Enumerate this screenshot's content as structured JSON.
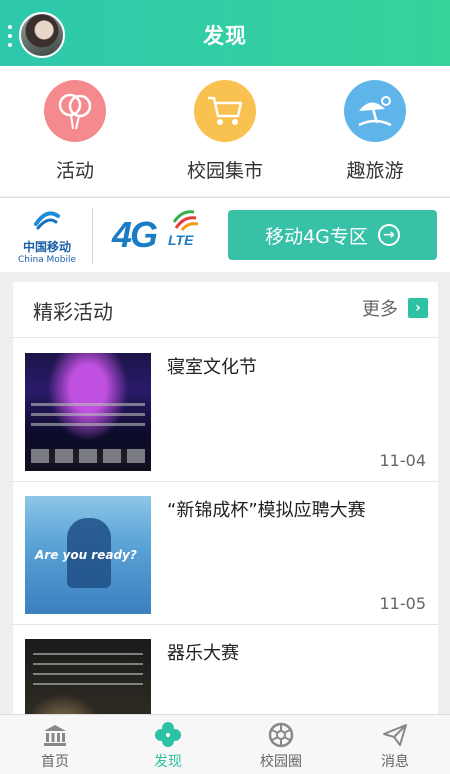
{
  "header": {
    "title": "发现"
  },
  "quick_nav": [
    {
      "label": "活动",
      "icon": "balloon-icon",
      "color": "#f48a8e"
    },
    {
      "label": "校园集市",
      "icon": "shopping-cart-icon",
      "color": "#f9c14f"
    },
    {
      "label": "趣旅游",
      "icon": "beach-umbrella-icon",
      "color": "#5fb5ea"
    }
  ],
  "banner": {
    "carrier_cn": "中国移动",
    "carrier_en": "China Mobile",
    "logo_4g": "4G",
    "logo_lte": "LTE",
    "zone_button": "移动4G专区"
  },
  "activities": {
    "title": "精彩活动",
    "more_label": "更多",
    "items": [
      {
        "title": "寝室文化节",
        "date": "11-04"
      },
      {
        "title": "“新锦成杯”模拟应聘大赛",
        "date": "11-05",
        "thumb_caption": "Are you ready?"
      },
      {
        "title": "器乐大赛",
        "date": ""
      }
    ]
  },
  "tabbar": [
    {
      "label": "首页",
      "icon": "bank-icon",
      "active": false
    },
    {
      "label": "发现",
      "icon": "clover-icon",
      "active": true
    },
    {
      "label": "校园圈",
      "icon": "aperture-icon",
      "active": false
    },
    {
      "label": "消息",
      "icon": "paper-plane-icon",
      "active": false
    }
  ],
  "colors": {
    "accent": "#2ec2a4",
    "header": "#35d39a"
  }
}
